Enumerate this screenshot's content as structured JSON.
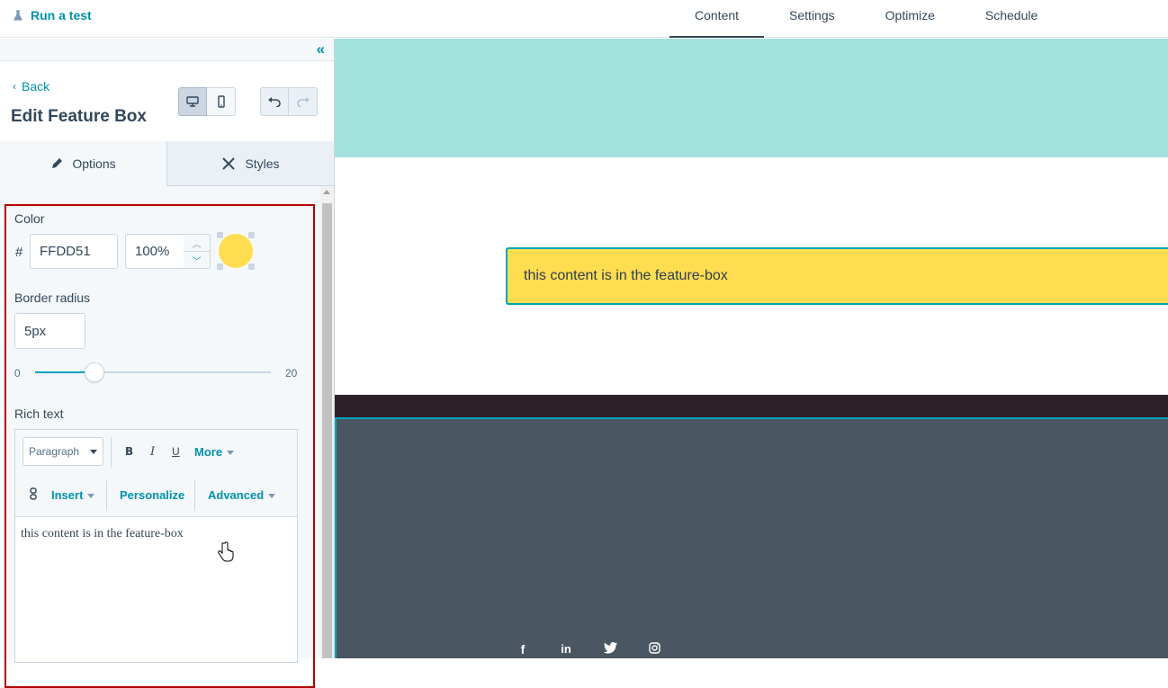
{
  "topbar": {
    "run_test": "Run a test",
    "tabs": [
      {
        "label": "Content"
      },
      {
        "label": "Settings"
      },
      {
        "label": "Optimize"
      },
      {
        "label": "Schedule"
      }
    ]
  },
  "panel": {
    "back_label": "Back",
    "title": "Edit Feature Box",
    "tab_options": "Options",
    "tab_styles": "Styles",
    "color": {
      "label": "Color",
      "hash": "#",
      "hex_value": "FFDD51",
      "opacity_value": "100%",
      "swatch_color": "#FFDD51"
    },
    "border_radius": {
      "label": "Border radius",
      "value": "5px",
      "min": "0",
      "max": "20",
      "level": 5
    },
    "rich_text": {
      "label": "Rich text",
      "paragraph": "Paragraph",
      "bold": "B",
      "italic": "I",
      "underline": "U",
      "more": "More",
      "insert": "Insert",
      "personalize": "Personalize",
      "advanced": "Advanced",
      "body": "this content is in the feature-box"
    }
  },
  "preview": {
    "feature_text": "this content is in the feature-box",
    "feature_color": "#FFDD51",
    "social": [
      "f",
      "in",
      "twitter-icon",
      "instagram-icon"
    ]
  },
  "colors": {
    "accent": "#0091ae",
    "highlight": "#b50000",
    "teal_band": "#a3e2dd",
    "footer": "#4a5661"
  }
}
